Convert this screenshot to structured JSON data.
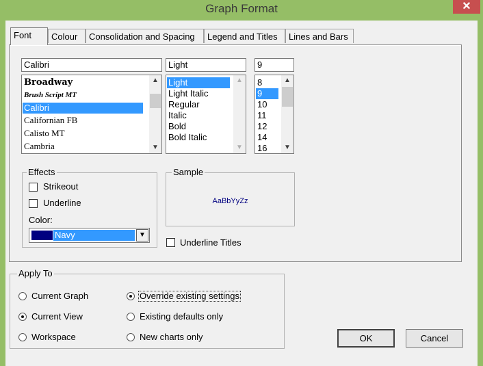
{
  "window": {
    "title": "Graph Format",
    "close_glyph": "✕"
  },
  "tabs": [
    {
      "label": "Font",
      "active": true
    },
    {
      "label": "Colour"
    },
    {
      "label": "Consolidation and Spacing"
    },
    {
      "label": "Legend and Titles"
    },
    {
      "label": "Lines and Bars"
    }
  ],
  "font": {
    "name_value": "Calibri",
    "names": [
      "Broadway",
      "Brush Script MT",
      "Calibri",
      "Californian FB",
      "Calisto MT",
      "Cambria"
    ],
    "selected_name": "Calibri",
    "style_value": "Light",
    "styles": [
      "Light",
      "Light Italic",
      "Regular",
      "Italic",
      "Bold",
      "Bold Italic"
    ],
    "selected_style": "Light",
    "size_value": "9",
    "sizes": [
      "8",
      "9",
      "10",
      "11",
      "12",
      "14",
      "16"
    ],
    "selected_size": "9"
  },
  "effects": {
    "label": "Effects",
    "strikeout": "Strikeout",
    "underline": "Underline",
    "color_label": "Color:",
    "color_value": "Navy",
    "color_hex": "#000080"
  },
  "sample": {
    "label": "Sample",
    "text": "AaBbYyZz"
  },
  "underline_titles": "Underline Titles",
  "apply_to": {
    "label": "Apply To",
    "options": [
      {
        "label": "Current Graph",
        "selected": false
      },
      {
        "label": "Current View",
        "selected": true
      },
      {
        "label": "Workspace",
        "selected": false
      }
    ],
    "options2": [
      {
        "label": "Override existing settings",
        "selected": true
      },
      {
        "label": "Existing defaults only",
        "selected": false
      },
      {
        "label": "New charts only",
        "selected": false
      }
    ]
  },
  "buttons": {
    "ok": "OK",
    "cancel": "Cancel"
  },
  "colors": {
    "frame": "#95be66",
    "close": "#c74f4f",
    "selection": "#3399ff",
    "sample_text": "#000080"
  }
}
